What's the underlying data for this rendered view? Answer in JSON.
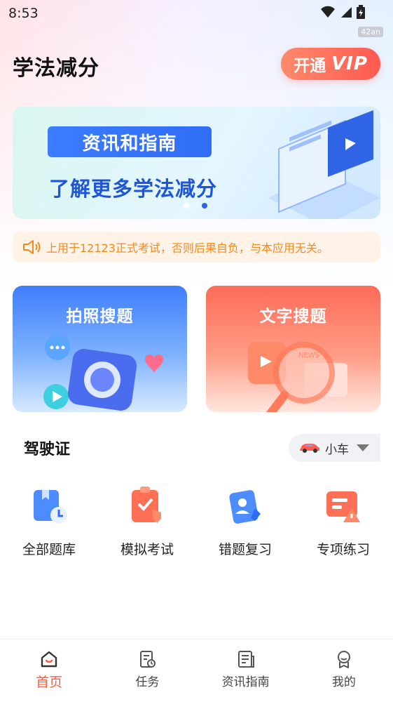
{
  "status_bar": {
    "time": "8:53",
    "badge": "42an"
  },
  "header": {
    "title": "学法减分",
    "vip_button": {
      "text": "开通",
      "mark": "VIP"
    }
  },
  "banner": {
    "tag": "资讯和指南",
    "subtitle": "了解更多学法减分",
    "dots": 2,
    "active_dot": 1
  },
  "notice": {
    "text": "上用于12123正式考试，否则后果自负，与本应用无关。"
  },
  "search_cards": [
    {
      "title": "拍照搜题",
      "icon": "camera-icon"
    },
    {
      "title": "文字搜题",
      "icon": "magnifier-icon"
    }
  ],
  "license_section": {
    "title": "驾驶证",
    "vehicle_selector": {
      "label": "小车",
      "icon": "car-icon"
    }
  },
  "features": [
    {
      "label": "全部题库",
      "icon": "question-bank-icon"
    },
    {
      "label": "模拟考试",
      "icon": "mock-exam-icon"
    },
    {
      "label": "错题复习",
      "icon": "wrong-review-icon"
    },
    {
      "label": "专项练习",
      "icon": "special-practice-icon"
    }
  ],
  "bottom_nav": [
    {
      "label": "首页",
      "icon": "home-icon",
      "active": true
    },
    {
      "label": "任务",
      "icon": "task-icon",
      "active": false
    },
    {
      "label": "资讯指南",
      "icon": "news-icon",
      "active": false
    },
    {
      "label": "我的",
      "icon": "profile-icon",
      "active": false
    }
  ],
  "colors": {
    "accent": "#ff5a3c",
    "primary_blue": "#2f6df5",
    "notice": "#f28a1e"
  }
}
